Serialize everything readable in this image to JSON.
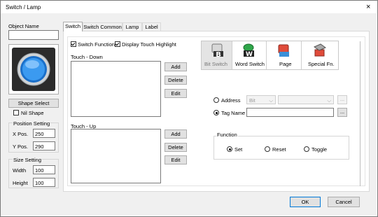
{
  "window": {
    "title": "Switch / Lamp",
    "close_glyph": "×"
  },
  "left": {
    "object_name_label": "Object Name",
    "object_name_value": "",
    "shape_select": "Shape Select",
    "nil_shape": "Nil Shape",
    "position_setting": "Position Setting",
    "x_pos_label": "X Pos.",
    "x_pos_value": "250",
    "y_pos_label": "Y Pos.",
    "y_pos_value": "290",
    "size_setting": "Size Setting",
    "width_label": "Width",
    "width_value": "100",
    "height_label": "Height",
    "height_value": "100"
  },
  "tabs": [
    {
      "label": "Switch",
      "active": true
    },
    {
      "label": "Switch Common",
      "active": false
    },
    {
      "label": "Lamp",
      "active": false
    },
    {
      "label": "Label",
      "active": false
    }
  ],
  "switch_tab": {
    "switch_function": "Switch Function",
    "display_touch_highlight": "Display Touch Highlight",
    "touch_down_label": "Touch - Down",
    "touch_up_label": "Touch - Up",
    "add": "Add",
    "delete": "Delete",
    "edit": "Edit",
    "type_buttons": [
      {
        "label": "Bit Switch",
        "icon": "bit-switch-icon",
        "letter": "B"
      },
      {
        "label": "Word Switch",
        "icon": "word-switch-icon",
        "letter": "W"
      },
      {
        "label": "Page",
        "icon": "page-icon",
        "letter": ""
      },
      {
        "label": "Special Fn.",
        "icon": "special-fn-icon",
        "letter": ""
      }
    ],
    "address_label": "Address",
    "address_type": "Bit",
    "tag_name_label": "Tag Name",
    "tag_name_value": "",
    "ellipsis": "...",
    "function_label": "Function",
    "function_options": [
      "Set",
      "Reset",
      "Toggle"
    ],
    "function_selected": "Set"
  },
  "footer": {
    "ok": "OK",
    "cancel": "Cancel"
  },
  "colors": {
    "accent": "#0078d7",
    "lamp_blue": "#2f8fe6",
    "word_green": "#2fa64a",
    "page_red": "#e04b3a"
  }
}
